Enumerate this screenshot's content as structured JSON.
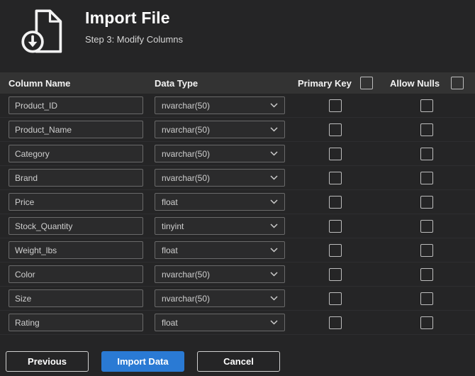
{
  "header": {
    "title": "Import File",
    "subtitle": "Step 3: Modify Columns"
  },
  "table": {
    "headers": {
      "column_name": "Column Name",
      "data_type": "Data Type",
      "primary_key": "Primary Key",
      "allow_nulls": "Allow Nulls"
    },
    "select_all": {
      "primary_key_checked": false,
      "allow_nulls_checked": false
    },
    "rows": [
      {
        "name": "Product_ID",
        "data_type": "nvarchar(50)",
        "primary_key": false,
        "allow_nulls": false
      },
      {
        "name": "Product_Name",
        "data_type": "nvarchar(50)",
        "primary_key": false,
        "allow_nulls": false
      },
      {
        "name": "Category",
        "data_type": "nvarchar(50)",
        "primary_key": false,
        "allow_nulls": false
      },
      {
        "name": "Brand",
        "data_type": "nvarchar(50)",
        "primary_key": false,
        "allow_nulls": false
      },
      {
        "name": "Price",
        "data_type": "float",
        "primary_key": false,
        "allow_nulls": false
      },
      {
        "name": "Stock_Quantity",
        "data_type": "tinyint",
        "primary_key": false,
        "allow_nulls": false
      },
      {
        "name": "Weight_lbs",
        "data_type": "float",
        "primary_key": false,
        "allow_nulls": false
      },
      {
        "name": "Color",
        "data_type": "nvarchar(50)",
        "primary_key": false,
        "allow_nulls": false
      },
      {
        "name": "Size",
        "data_type": "nvarchar(50)",
        "primary_key": false,
        "allow_nulls": false
      },
      {
        "name": "Rating",
        "data_type": "float",
        "primary_key": false,
        "allow_nulls": false
      }
    ]
  },
  "buttons": {
    "previous": "Previous",
    "import_data": "Import Data",
    "cancel": "Cancel"
  },
  "icons": {
    "header_icon": "import-file-icon",
    "dropdown_icon": "chevron-down-icon"
  },
  "colors": {
    "background": "#252526",
    "table_header_bg": "#333333",
    "accent_button": "#2a7ad4",
    "text": "#ffffff",
    "muted_text": "#d6d6d6",
    "input_border": "#6a6a6a"
  }
}
